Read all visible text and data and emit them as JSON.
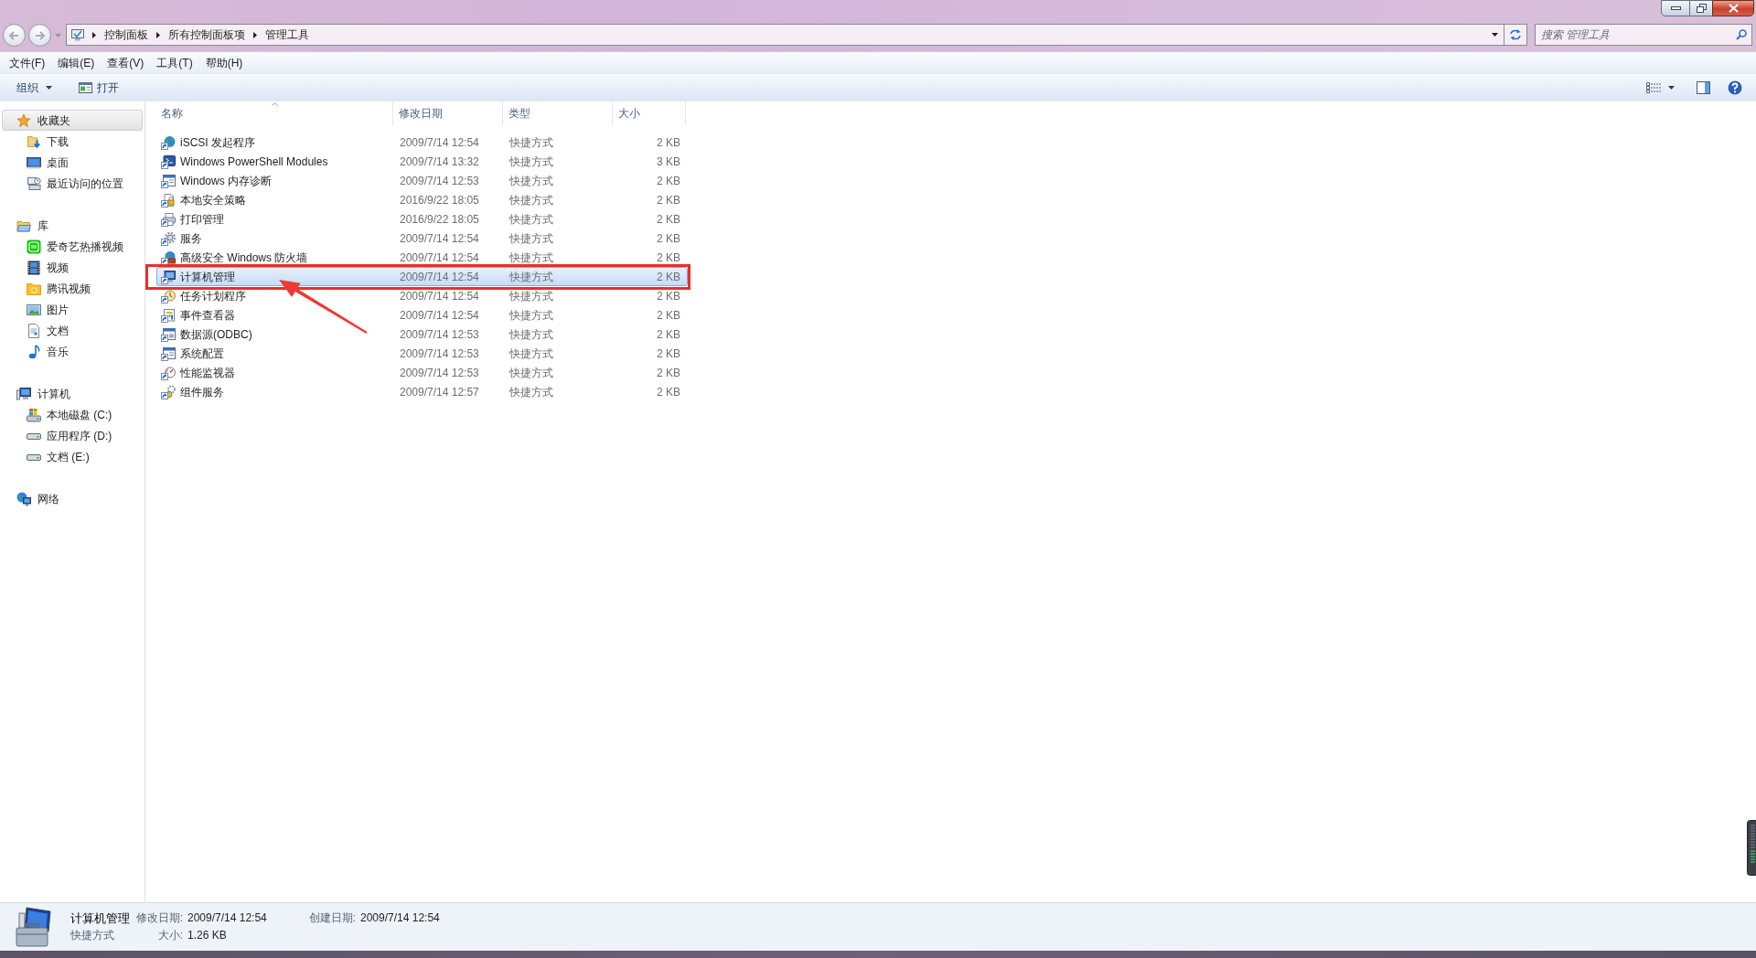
{
  "address_bar": {
    "path": [
      "控制面板",
      "所有控制面板项",
      "管理工具"
    ]
  },
  "search": {
    "placeholder": "搜索 管理工具"
  },
  "menu_bar": [
    "文件(F)",
    "编辑(E)",
    "查看(V)",
    "工具(T)",
    "帮助(H)"
  ],
  "toolbar": [
    {
      "label": "组织",
      "kind": "menu"
    },
    {
      "label": "打开",
      "kind": "open"
    }
  ],
  "sidebar": [
    {
      "label": "收藏夹",
      "kind": "star",
      "selected": true,
      "children": [
        {
          "label": "下载",
          "kind": "download",
          "selected": false
        },
        {
          "label": "桌面",
          "kind": "desktop",
          "selected": false
        },
        {
          "label": "最近访问的位置",
          "kind": "recent",
          "selected": false
        }
      ]
    },
    {
      "label": "库",
      "kind": "library",
      "selected": false,
      "children": [
        {
          "label": "爱奇艺热播视频",
          "kind": "app",
          "selected": false
        },
        {
          "label": "视频",
          "kind": "film",
          "selected": false
        },
        {
          "label": "腾讯视频",
          "kind": "playfolder",
          "selected": false
        },
        {
          "label": "图片",
          "kind": "picture",
          "selected": false
        },
        {
          "label": "文档",
          "kind": "document",
          "selected": false
        },
        {
          "label": "音乐",
          "kind": "music",
          "selected": false
        }
      ]
    },
    {
      "label": "计算机",
      "kind": "computer",
      "selected": false,
      "children": [
        {
          "label": "本地磁盘 (C:)",
          "kind": "systemdrive",
          "selected": false
        },
        {
          "label": "应用程序 (D:)",
          "kind": "drive",
          "selected": false
        },
        {
          "label": "文档 (E:)",
          "kind": "drive",
          "selected": false
        }
      ]
    },
    {
      "label": "网络",
      "kind": "network",
      "selected": false
    }
  ],
  "file_list": {
    "columns": [
      {
        "label": "名称",
        "sorted": true
      },
      {
        "label": "修改日期",
        "sorted": false
      },
      {
        "label": "类型",
        "sorted": false
      },
      {
        "label": "大小",
        "sorted": false
      }
    ],
    "rows": [
      {
        "name": "iSCSI 发起程序",
        "modified": "2009/7/14 12:54",
        "type": "快捷方式",
        "size": "2 KB",
        "kind": "globe",
        "selected": false,
        "marked": false
      },
      {
        "name": "Windows PowerShell Modules",
        "modified": "2009/7/14 13:32",
        "type": "快捷方式",
        "size": "3 KB",
        "kind": "console",
        "selected": false,
        "marked": false
      },
      {
        "name": "Windows 内存诊断",
        "modified": "2009/7/14 12:53",
        "type": "快捷方式",
        "size": "2 KB",
        "kind": "window",
        "selected": false,
        "marked": false
      },
      {
        "name": "本地安全策略",
        "modified": "2016/9/22 18:05",
        "type": "快捷方式",
        "size": "2 KB",
        "kind": "lock",
        "selected": false,
        "marked": false
      },
      {
        "name": "打印管理",
        "modified": "2016/9/22 18:05",
        "type": "快捷方式",
        "size": "2 KB",
        "kind": "printer",
        "selected": false,
        "marked": false
      },
      {
        "name": "服务",
        "modified": "2009/7/14 12:54",
        "type": "快捷方式",
        "size": "2 KB",
        "kind": "gear",
        "selected": false,
        "marked": false
      },
      {
        "name": "高级安全 Windows 防火墙",
        "modified": "2009/7/14 12:54",
        "type": "快捷方式",
        "size": "2 KB",
        "kind": "firewall",
        "selected": false,
        "marked": false
      },
      {
        "name": "计算机管理",
        "modified": "2009/7/14 12:54",
        "type": "快捷方式",
        "size": "2 KB",
        "kind": "computer",
        "selected": true,
        "marked": true
      },
      {
        "name": "任务计划程序",
        "modified": "2009/7/14 12:54",
        "type": "快捷方式",
        "size": "2 KB",
        "kind": "clock",
        "selected": false,
        "marked": false
      },
      {
        "name": "事件查看器",
        "modified": "2009/7/14 12:54",
        "type": "快捷方式",
        "size": "2 KB",
        "kind": "log",
        "selected": false,
        "marked": false
      },
      {
        "name": "数据源(ODBC)",
        "modified": "2009/7/14 12:53",
        "type": "快捷方式",
        "size": "2 KB",
        "kind": "database",
        "selected": false,
        "marked": false
      },
      {
        "name": "系统配置",
        "modified": "2009/7/14 12:53",
        "type": "快捷方式",
        "size": "2 KB",
        "kind": "window",
        "selected": false,
        "marked": false
      },
      {
        "name": "性能监视器",
        "modified": "2009/7/14 12:53",
        "type": "快捷方式",
        "size": "2 KB",
        "kind": "gauge",
        "selected": false,
        "marked": false
      },
      {
        "name": "组件服务",
        "modified": "2009/7/14 12:57",
        "type": "快捷方式",
        "size": "2 KB",
        "kind": "gears",
        "selected": false,
        "marked": false
      }
    ]
  },
  "details": {
    "name": "计算机管理",
    "type": "快捷方式",
    "fields": [
      {
        "label": "修改日期:",
        "value": "2009/7/14 12:54"
      },
      {
        "label": "创建日期:",
        "value": "2009/7/14 12:54"
      },
      {
        "label": "大小:",
        "value": "1.26 KB"
      }
    ]
  }
}
